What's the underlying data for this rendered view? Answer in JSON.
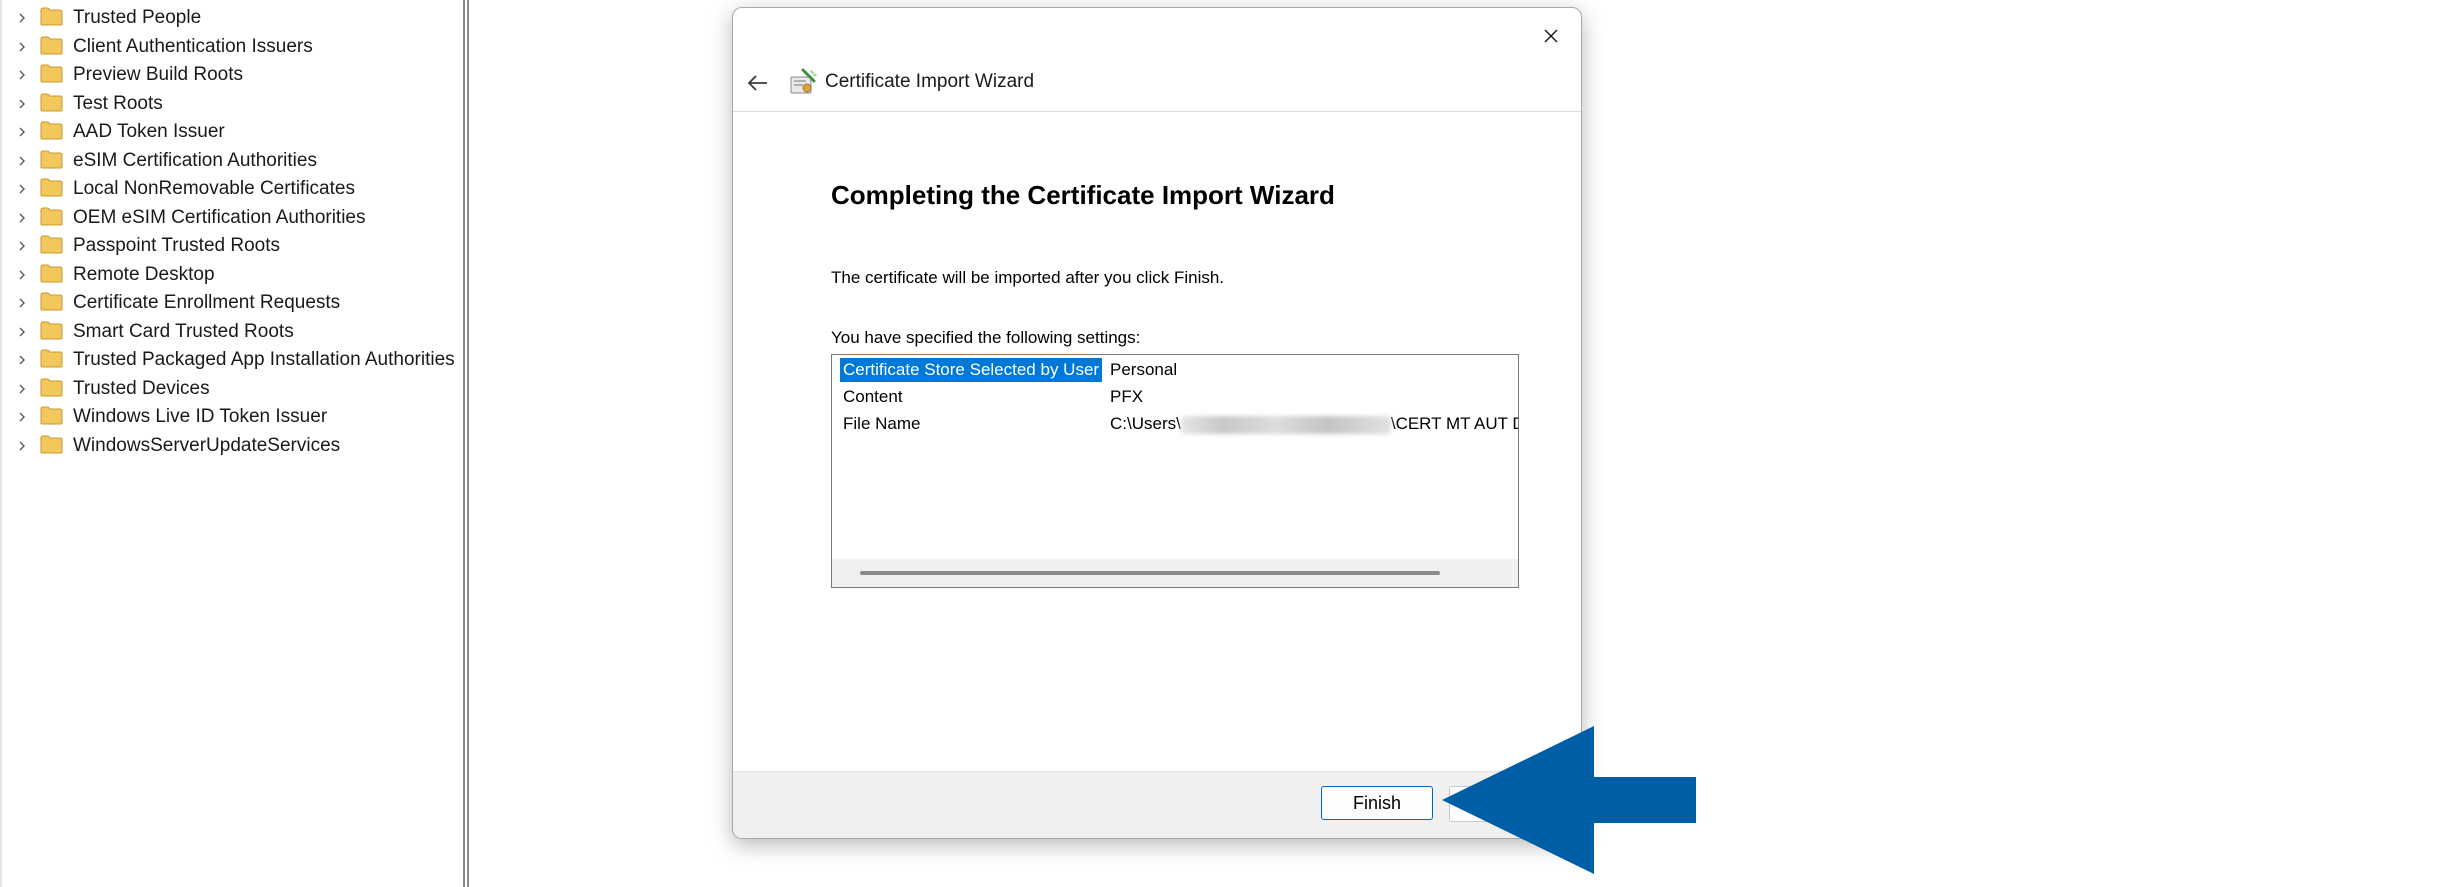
{
  "tree": {
    "items": [
      {
        "label": "Trusted People"
      },
      {
        "label": "Client Authentication Issuers"
      },
      {
        "label": "Preview Build Roots"
      },
      {
        "label": "Test Roots"
      },
      {
        "label": "AAD Token Issuer"
      },
      {
        "label": "eSIM Certification Authorities"
      },
      {
        "label": "Local NonRemovable Certificates"
      },
      {
        "label": "OEM eSIM Certification Authorities"
      },
      {
        "label": "Passpoint Trusted Roots"
      },
      {
        "label": "Remote Desktop"
      },
      {
        "label": "Certificate Enrollment Requests"
      },
      {
        "label": "Smart Card Trusted Roots"
      },
      {
        "label": "Trusted Packaged App Installation Authorities"
      },
      {
        "label": "Trusted Devices"
      },
      {
        "label": "Windows Live ID Token Issuer"
      },
      {
        "label": "WindowsServerUpdateServices"
      }
    ],
    "folder_color": "#f2c75c"
  },
  "dialog": {
    "title": "Certificate Import Wizard",
    "heading": "Completing the Certificate Import Wizard",
    "import_note": "The certificate will be imported after you click Finish.",
    "settings_caption": "You have specified the following settings:",
    "settings": [
      {
        "name": "Certificate Store Selected by User",
        "value": "Personal",
        "selected": true
      },
      {
        "name": "Content",
        "value": "PFX",
        "selected": false
      },
      {
        "name": "File Name",
        "value_prefix": "C:\\Users\\",
        "value_suffix": "\\CERT MT AUT D",
        "selected": false
      }
    ],
    "finish_label": "Finish",
    "icons": {
      "close": "close-icon",
      "back": "back-arrow-icon",
      "wizard": "certificate-wizard-icon"
    }
  },
  "annotation": {
    "arrow_color": "#005ea6",
    "arrow_direction": "left"
  },
  "colors": {
    "selection": "#0078d7",
    "accent": "#0067c0"
  }
}
